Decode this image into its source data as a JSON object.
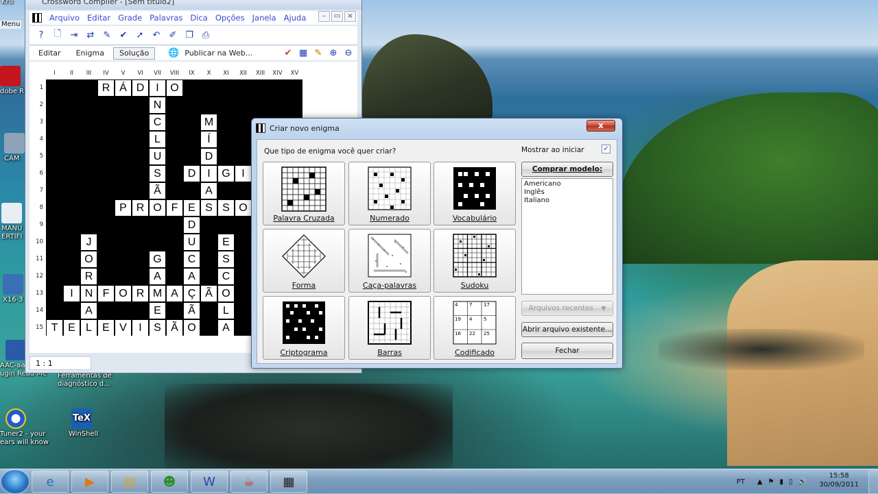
{
  "desktop": {
    "icons": [
      {
        "label": "Kru",
        "icon": "app-icon"
      },
      {
        "label": "Menu",
        "icon": "menu-icon"
      },
      {
        "label": "dobe R",
        "icon": "adobe-reader-icon"
      },
      {
        "label": "CAM",
        "icon": "camera-icon"
      },
      {
        "label": "MANU ERTIFI",
        "icon": "document-icon"
      },
      {
        "label": "X16-3",
        "icon": "installer-icon"
      },
      {
        "label": "AAC-aacPlus ugin Read Me",
        "icon": "word-document-icon"
      },
      {
        "label": "Ferramentas de diagnóstico d...",
        "icon": "tools-icon"
      },
      {
        "label": "Tuner2 - your ears will know",
        "icon": "tuner-icon"
      },
      {
        "label": "WinShell",
        "icon": "tex-icon",
        "badge": "TeX"
      }
    ]
  },
  "main_window": {
    "title": "Crossword Compiler - [Sem título2]",
    "menu": [
      "Arquivo",
      "Editar",
      "Grade",
      "Palavras",
      "Dica",
      "Opções",
      "Janela",
      "Ajuda"
    ],
    "window_buttons": {
      "minimize": "–",
      "restore": "▭",
      "close": "×"
    },
    "toolbar_icons": [
      "help-icon",
      "new-icon",
      "insert-icon",
      "move-icon",
      "spell-icon",
      "check-icon",
      "arrow-icon",
      "undo-icon",
      "edit-icon",
      "copy-icon",
      "print-icon"
    ],
    "toolbar_glyphs": [
      "?",
      "🗋",
      "⇥",
      "⇄",
      "✎",
      "✔",
      "➚",
      "↶",
      "✐",
      "❐",
      "⎙"
    ],
    "tabs": [
      "Editar",
      "Enigma",
      "Solução"
    ],
    "active_tab": "Solução",
    "publish_label": "Publicar na Web...",
    "publish_glyph": "🌐",
    "right_icons": [
      "checkmark-icon",
      "calculator-icon",
      "pencil-icon",
      "zoom-in-icon",
      "zoom-out-icon"
    ],
    "right_glyphs": [
      "✔",
      "▦",
      "✎",
      "⊕",
      "⊖"
    ],
    "status": "1 : 1",
    "grid": {
      "columns": [
        "I",
        "II",
        "III",
        "IV",
        "V",
        "VI",
        "VII",
        "VIII",
        "IX",
        "X",
        "XI",
        "XII",
        "XIII",
        "XIV",
        "XV"
      ],
      "rows": [
        "1",
        "2",
        "3",
        "4",
        "5",
        "6",
        "7",
        "8",
        "9",
        "10",
        "11",
        "12",
        "13",
        "14",
        "15"
      ],
      "cells": [
        {
          "r": 1,
          "c": 4,
          "ch": "R"
        },
        {
          "r": 1,
          "c": 5,
          "ch": "Á"
        },
        {
          "r": 1,
          "c": 6,
          "ch": "D"
        },
        {
          "r": 1,
          "c": 7,
          "ch": "I"
        },
        {
          "r": 1,
          "c": 8,
          "ch": "O"
        },
        {
          "r": 2,
          "c": 7,
          "ch": "N"
        },
        {
          "r": 3,
          "c": 7,
          "ch": "C"
        },
        {
          "r": 3,
          "c": 10,
          "ch": "M"
        },
        {
          "r": 4,
          "c": 7,
          "ch": "L"
        },
        {
          "r": 4,
          "c": 10,
          "ch": "Í"
        },
        {
          "r": 5,
          "c": 7,
          "ch": "U"
        },
        {
          "r": 5,
          "c": 10,
          "ch": "D"
        },
        {
          "r": 6,
          "c": 7,
          "ch": "S"
        },
        {
          "r": 6,
          "c": 9,
          "ch": "D"
        },
        {
          "r": 6,
          "c": 10,
          "ch": "I"
        },
        {
          "r": 6,
          "c": 11,
          "ch": "G"
        },
        {
          "r": 6,
          "c": 12,
          "ch": "I"
        },
        {
          "r": 7,
          "c": 7,
          "ch": "Ã"
        },
        {
          "r": 7,
          "c": 10,
          "ch": "A"
        },
        {
          "r": 8,
          "c": 5,
          "ch": "P"
        },
        {
          "r": 8,
          "c": 6,
          "ch": "R"
        },
        {
          "r": 8,
          "c": 7,
          "ch": "O"
        },
        {
          "r": 8,
          "c": 8,
          "ch": "F"
        },
        {
          "r": 8,
          "c": 9,
          "ch": "E"
        },
        {
          "r": 8,
          "c": 10,
          "ch": "S"
        },
        {
          "r": 8,
          "c": 11,
          "ch": "S"
        },
        {
          "r": 8,
          "c": 12,
          "ch": "O"
        },
        {
          "r": 9,
          "c": 9,
          "ch": "D"
        },
        {
          "r": 10,
          "c": 3,
          "ch": "J"
        },
        {
          "r": 10,
          "c": 9,
          "ch": "U"
        },
        {
          "r": 10,
          "c": 11,
          "ch": "E"
        },
        {
          "r": 11,
          "c": 3,
          "ch": "O"
        },
        {
          "r": 11,
          "c": 7,
          "ch": "G"
        },
        {
          "r": 11,
          "c": 9,
          "ch": "C"
        },
        {
          "r": 11,
          "c": 11,
          "ch": "S"
        },
        {
          "r": 12,
          "c": 3,
          "ch": "R"
        },
        {
          "r": 12,
          "c": 7,
          "ch": "A"
        },
        {
          "r": 12,
          "c": 9,
          "ch": "A"
        },
        {
          "r": 12,
          "c": 11,
          "ch": "C"
        },
        {
          "r": 13,
          "c": 2,
          "ch": "I"
        },
        {
          "r": 13,
          "c": 3,
          "ch": "N"
        },
        {
          "r": 13,
          "c": 4,
          "ch": "F"
        },
        {
          "r": 13,
          "c": 5,
          "ch": "O"
        },
        {
          "r": 13,
          "c": 6,
          "ch": "R"
        },
        {
          "r": 13,
          "c": 7,
          "ch": "M"
        },
        {
          "r": 13,
          "c": 8,
          "ch": "A"
        },
        {
          "r": 13,
          "c": 9,
          "ch": "Ç"
        },
        {
          "r": 13,
          "c": 10,
          "ch": "Ã"
        },
        {
          "r": 13,
          "c": 11,
          "ch": "O"
        },
        {
          "r": 14,
          "c": 3,
          "ch": "A"
        },
        {
          "r": 14,
          "c": 7,
          "ch": "E"
        },
        {
          "r": 14,
          "c": 9,
          "ch": "Ã"
        },
        {
          "r": 14,
          "c": 11,
          "ch": "L"
        },
        {
          "r": 15,
          "c": 1,
          "ch": "T"
        },
        {
          "r": 15,
          "c": 2,
          "ch": "E"
        },
        {
          "r": 15,
          "c": 3,
          "ch": "L"
        },
        {
          "r": 15,
          "c": 4,
          "ch": "E"
        },
        {
          "r": 15,
          "c": 5,
          "ch": "V"
        },
        {
          "r": 15,
          "c": 6,
          "ch": "I"
        },
        {
          "r": 15,
          "c": 7,
          "ch": "S"
        },
        {
          "r": 15,
          "c": 8,
          "ch": "Ã"
        },
        {
          "r": 15,
          "c": 9,
          "ch": "O"
        },
        {
          "r": 15,
          "c": 11,
          "ch": "A"
        }
      ]
    }
  },
  "dialog": {
    "title": "Criar novo enigma",
    "close_label": "x",
    "question": "Que tipo de enigma você quer criar?",
    "show_on_start_label": "Mostrar ao iniciar",
    "show_on_start_checked": true,
    "check_mark": "✓",
    "buy_label": "Comprar modelo:",
    "models": [
      "Americano",
      "Inglês",
      "Italiano"
    ],
    "recent_label": "Arquivos recentes",
    "recent_arrow": "▼",
    "open_label": "Abrir arquivo existente...",
    "close_button_label": "Fechar",
    "puzzle_types": [
      "Palavra Cruzada",
      "Numerado",
      "Vocabulário",
      "Forma",
      "Caça-palavras",
      "Sudoku",
      "Criptograma",
      "Barras",
      "Codificado"
    ],
    "codificado_numbers": [
      "4",
      "7",
      "17",
      "19",
      "4",
      "5",
      "16",
      "22",
      "25"
    ]
  },
  "taskbar": {
    "buttons": [
      {
        "name": "internet-explorer",
        "glyph": "e",
        "color": "#1a73c8"
      },
      {
        "name": "media-player",
        "glyph": "▶",
        "color": "#e07a12"
      },
      {
        "name": "explorer",
        "glyph": "▤",
        "color": "#d9a520"
      },
      {
        "name": "messenger",
        "glyph": "☻",
        "color": "#2b8f2b"
      },
      {
        "name": "word",
        "glyph": "W",
        "color": "#1f4e9c"
      },
      {
        "name": "java",
        "glyph": "☕",
        "color": "#c0392b"
      },
      {
        "name": "crossword-compiler",
        "glyph": "▦",
        "color": "#222222"
      }
    ],
    "language": "PT",
    "tray_icons": [
      "up-arrow-icon",
      "flag-icon",
      "network-icon",
      "battery-icon",
      "volume-icon"
    ],
    "tray_glyphs": [
      "▲",
      "⚑",
      "▮",
      "▯",
      "🔊"
    ],
    "time": "15:58",
    "date": "30/09/2011"
  }
}
